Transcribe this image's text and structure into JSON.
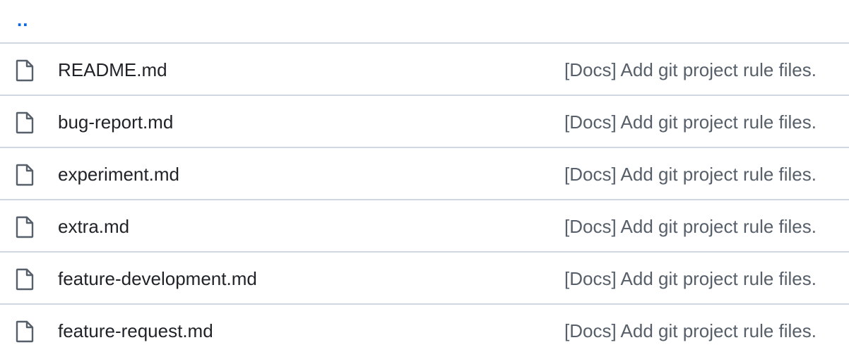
{
  "parent": {
    "label": ".."
  },
  "files": [
    {
      "name": "README.md",
      "commit": "[Docs] Add git project rule files.",
      "icon": "file-icon"
    },
    {
      "name": "bug-report.md",
      "commit": "[Docs] Add git project rule files.",
      "icon": "file-icon"
    },
    {
      "name": "experiment.md",
      "commit": "[Docs] Add git project rule files.",
      "icon": "file-icon"
    },
    {
      "name": "extra.md",
      "commit": "[Docs] Add git project rule files.",
      "icon": "file-icon"
    },
    {
      "name": "feature-development.md",
      "commit": "[Docs] Add git project rule files.",
      "icon": "file-icon"
    },
    {
      "name": "feature-request.md",
      "commit": "[Docs] Add git project rule files.",
      "icon": "file-icon"
    }
  ],
  "colors": {
    "link": "#0969da",
    "text": "#1f2328",
    "muted": "#57606a",
    "border": "#d0d7de"
  }
}
